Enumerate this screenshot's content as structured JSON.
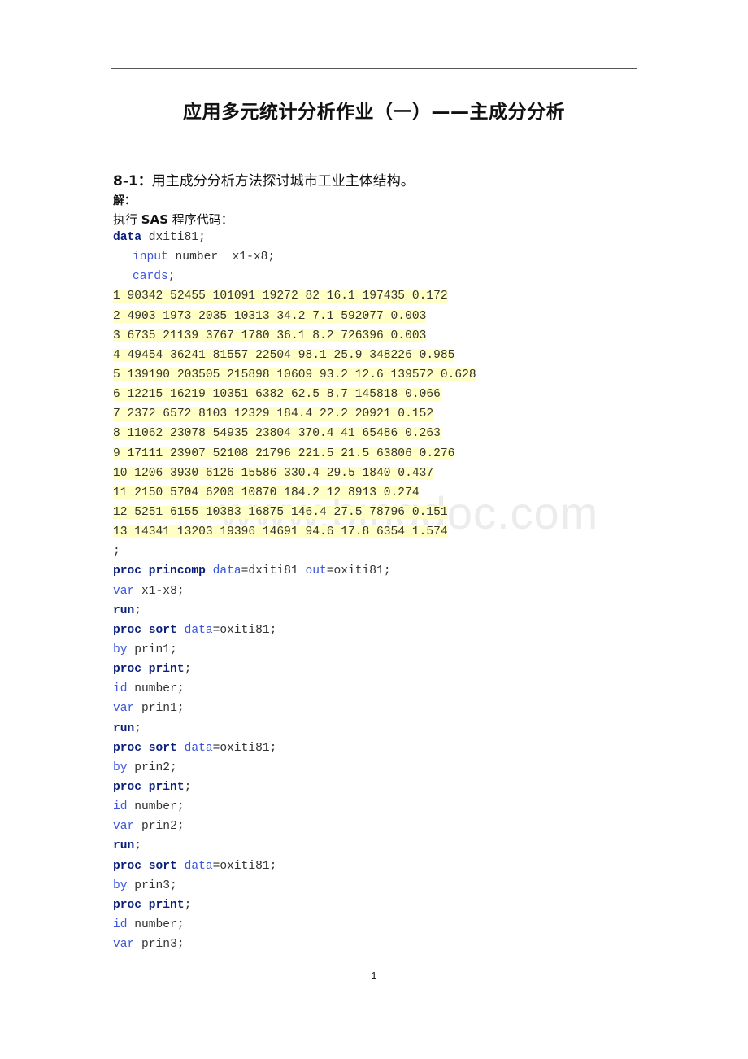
{
  "document": {
    "title": "应用多元统计分析作业（一）——主成分分析",
    "question": {
      "number": "8-1：",
      "text": "用主成分分析方法探讨城市工业主体结构。"
    },
    "solution_label": "解：",
    "exec_label": {
      "prefix": "执行 ",
      "sas": "SAS",
      "suffix": " 程序代码："
    },
    "watermark": "www.bingdoc.com",
    "page_number": "1"
  },
  "code": {
    "header": [
      {
        "kw": "data",
        "rest": " dxiti81;"
      },
      {
        "opt": "input",
        "rest": " number  x1-x8;"
      },
      {
        "opt": "cards",
        "rest": ";"
      }
    ],
    "data_rows": [
      "1 90342 52455 101091 19272 82 16.1 197435 0.172",
      "2 4903 1973 2035 10313 34.2 7.1 592077 0.003",
      "3 6735 21139 3767 1780 36.1 8.2 726396 0.003",
      "4 49454 36241 81557 22504 98.1 25.9 348226 0.985",
      "5 139190 203505 215898 10609 93.2 12.6 139572 0.628",
      "6 12215 16219 10351 6382 62.5 8.7 145818 0.066",
      "7 2372 6572 8103 12329 184.4 22.2 20921 0.152",
      "8 11062 23078 54935 23804 370.4 41 65486 0.263",
      "9 17111 23907 52108 21796 221.5 21.5 63806 0.276",
      "10 1206 3930 6126 15586 330.4 29.5 1840 0.437",
      "11 2150 5704 6200 10870 184.2 12 8913 0.274",
      "12 5251 6155 10383 16875 146.4 27.5 78796 0.151",
      "13 14341 13203 19396 14691 94.6 17.8 6354 1.574"
    ],
    "terminator": ";",
    "princomp": {
      "kw": "proc princomp",
      "opt1": "data",
      "val1": "=dxiti81 ",
      "opt2": "out",
      "val2": "=oxiti81;"
    },
    "princomp_var": {
      "opt": "var",
      "rest": " x1-x8;"
    },
    "run": "run",
    "semicolon": ";",
    "blocks": [
      {
        "sort_kw": "proc sort",
        "sort_opt": "data",
        "sort_val": "=oxiti81;",
        "by_opt": "by",
        "by_val": " prin1;",
        "print_kw": "proc print",
        "id_opt": "id",
        "id_val": " number;",
        "var_opt": "var",
        "var_val": " prin1;"
      },
      {
        "sort_kw": "proc sort",
        "sort_opt": "data",
        "sort_val": "=oxiti81;",
        "by_opt": "by",
        "by_val": " prin2;",
        "print_kw": "proc print",
        "id_opt": "id",
        "id_val": " number;",
        "var_opt": "var",
        "var_val": " prin2;"
      },
      {
        "sort_kw": "proc sort",
        "sort_opt": "data",
        "sort_val": "=oxiti81;",
        "by_opt": "by",
        "by_val": " prin3;",
        "print_kw": "proc print",
        "id_opt": "id",
        "id_val": " number;",
        "var_opt": "var",
        "var_val": " prin3;"
      }
    ]
  },
  "colors": {
    "keyword": "#0a1e7a",
    "option": "#3a56e0",
    "text": "#333333",
    "highlight": "#ffffc6"
  }
}
